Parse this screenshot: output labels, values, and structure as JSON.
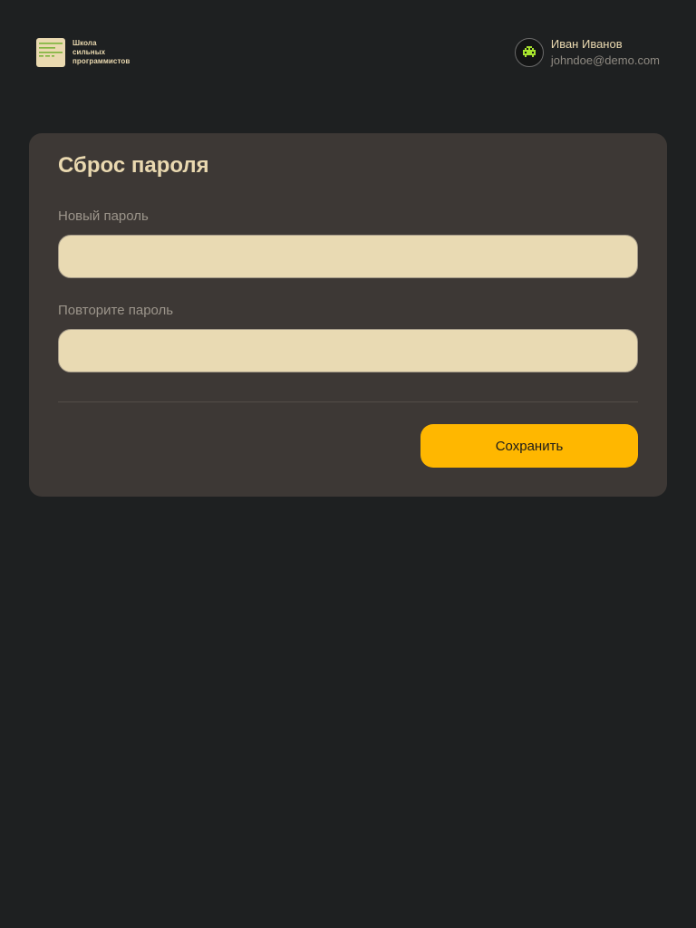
{
  "header": {
    "logo": {
      "lines": [
        "Школа",
        "сильных",
        "программистов"
      ]
    },
    "user": {
      "name": "Иван Иванов",
      "email": "johndoe@demo.com"
    }
  },
  "form": {
    "title": "Сброс пароля",
    "new_password": {
      "label": "Новый пароль",
      "value": ""
    },
    "repeat_password": {
      "label": "Повторите пароль",
      "value": ""
    },
    "save_label": "Сохранить"
  },
  "colors": {
    "background": "#1e2021",
    "card": "#3d3835",
    "accent": "#ffb700",
    "input": "#e9dab3",
    "text_primary": "#ead9b0"
  }
}
